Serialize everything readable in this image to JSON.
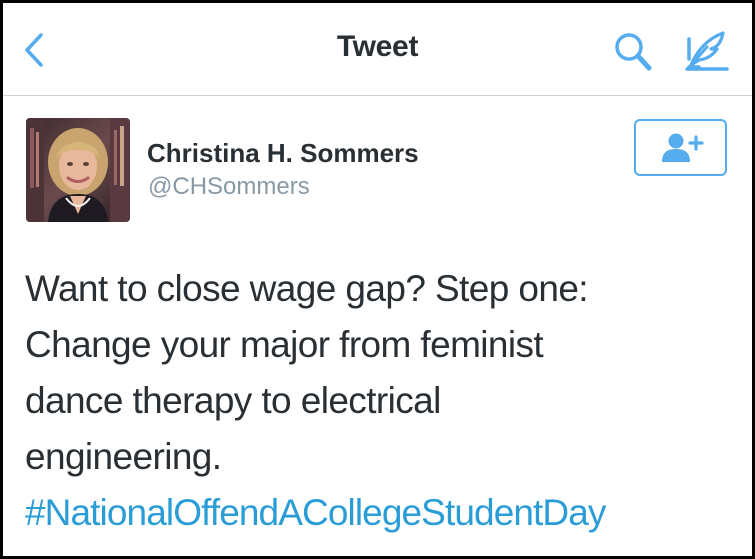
{
  "navbar": {
    "title": "Tweet",
    "back_icon": "chevron-left-icon",
    "search_icon": "search-icon",
    "compose_icon": "compose-quill-icon"
  },
  "author": {
    "display_name": "Christina H. Sommers",
    "handle": "@CHSommers",
    "follow_icon": "add-user-icon"
  },
  "tweet": {
    "lines": [
      "Want to close wage gap? Step one:",
      "Change your major from feminist",
      "dance therapy to electrical",
      "engineering."
    ],
    "hashtag": "#NationalOffendACollegeStudentDay"
  },
  "colors": {
    "accent": "#55acee",
    "text": "#292f33",
    "muted": "#8899a6",
    "hashtag": "#2a9dd6"
  }
}
